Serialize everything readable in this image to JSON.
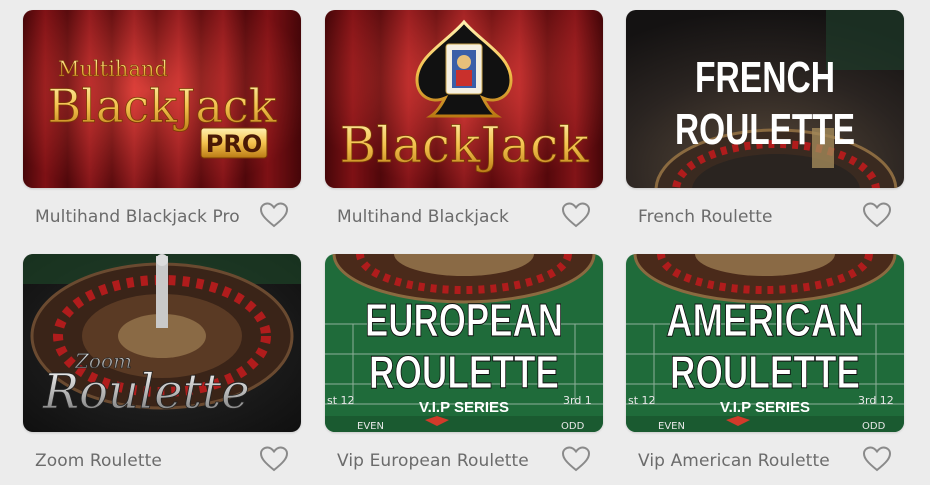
{
  "games": [
    {
      "title": "Multihand Blackjack Pro",
      "art": {
        "line1": "Multihand",
        "line2": "BlackJack",
        "badge": "PRO"
      }
    },
    {
      "title": "Multihand Blackjack",
      "art": {
        "word": "BlackJack"
      }
    },
    {
      "title": "French Roulette",
      "art": {
        "line1": "FRENCH",
        "line2": "ROULETTE"
      }
    },
    {
      "title": "Zoom Roulette",
      "art": {
        "line1": "Zoom",
        "line2": "Roulette"
      }
    },
    {
      "title": "Vip European Roulette",
      "art": {
        "line1": "EUROPEAN",
        "line2": "ROULETTE",
        "line3": "V.I.P SERIES",
        "table_left": "st 12",
        "table_right": "3rd 1",
        "even": "EVEN",
        "odd": "ODD"
      }
    },
    {
      "title": "Vip American Roulette",
      "art": {
        "line1": "AMERICAN",
        "line2": "ROULETTE",
        "line3": "V.I.P SERIES",
        "table_left": "st 12",
        "table_right": "3rd 12",
        "even": "EVEN",
        "odd": "ODD"
      }
    }
  ],
  "icons": {
    "favorite": "heart-outline-icon"
  },
  "colors": {
    "background": "#ececec",
    "title_text": "#6b6b6b",
    "heart": "#8a8a8a",
    "curtain_red": "#b5141b",
    "gold": "#f2c14e",
    "felt_green": "#1f6b3a"
  }
}
